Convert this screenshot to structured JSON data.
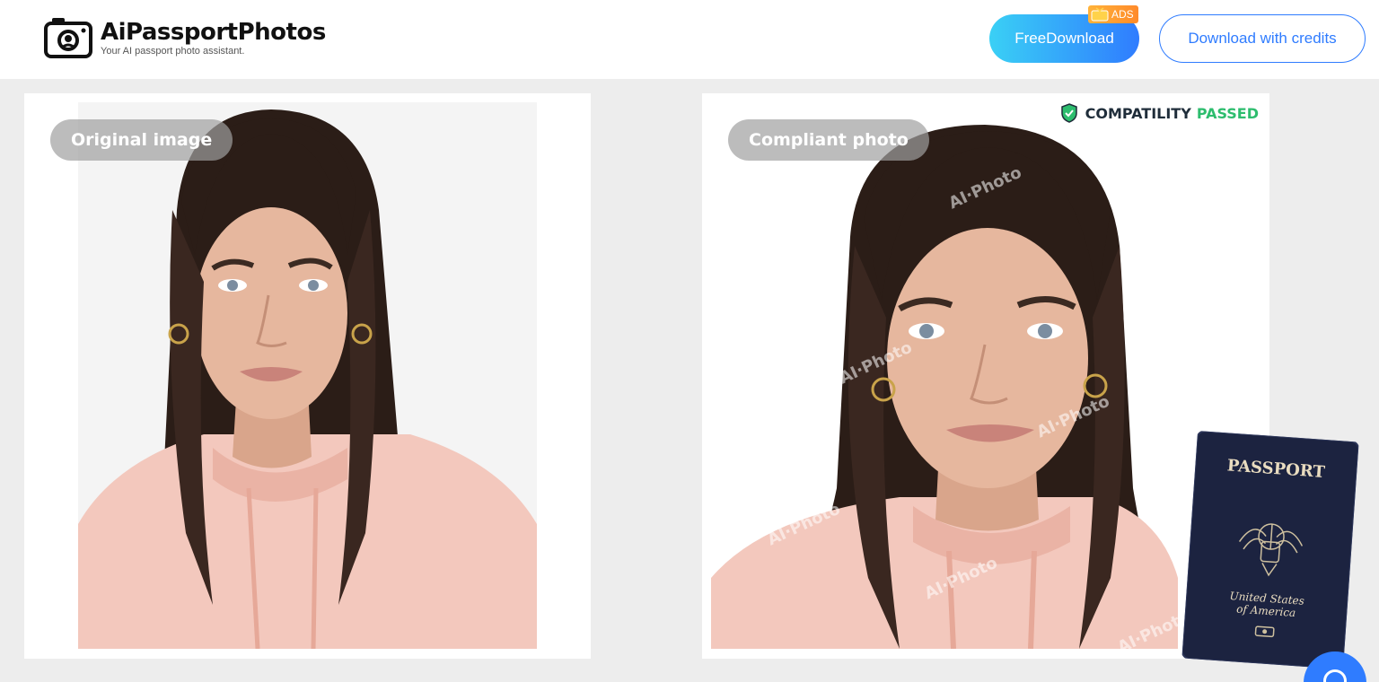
{
  "header": {
    "brand": "AiPassportPhotos",
    "tagline": "Your AI passport photo assistant.",
    "free_download_label": "FreeDownload",
    "ads_badge": "ADS",
    "download_credits_label": "Download with credits"
  },
  "original": {
    "chip_label": "Original image"
  },
  "compliant": {
    "chip_label": "Compliant photo",
    "compat_label": "COMPATILITY",
    "compat_status": "PASSED",
    "watermark": "AI·Photo"
  },
  "passport": {
    "title": "PASSPORT",
    "country_line1": "United States",
    "country_line2": "of America"
  },
  "colors": {
    "accent": "#2f7cff",
    "passed": "#2dbd6e",
    "passport_cover": "#1c2340",
    "hoodie": "#f3c8bd",
    "hair": "#2b1d17",
    "skin": "#e6b79e"
  },
  "icons": [
    "camera-logo-icon",
    "tv-icon",
    "shield-check-icon",
    "chat-icon"
  ]
}
